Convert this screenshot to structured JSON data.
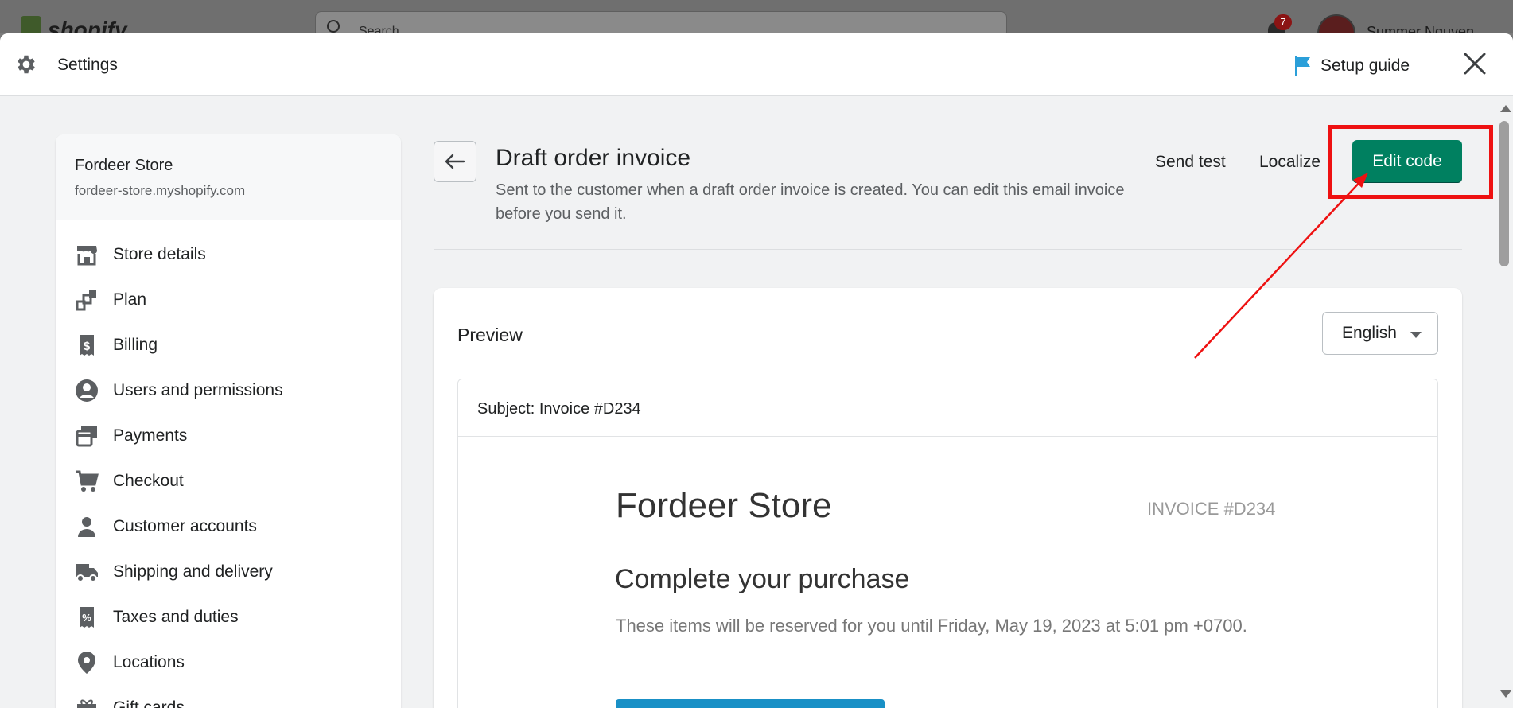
{
  "topbar": {
    "logo": "shopify",
    "search_placeholder": "Search",
    "notification_count": "7",
    "user_name": "Summer Nguyen"
  },
  "header": {
    "title": "Settings",
    "setup_guide": "Setup guide"
  },
  "sidebar": {
    "store_name": "Fordeer Store",
    "store_url": "fordeer-store.myshopify.com",
    "items": [
      {
        "label": "Store details",
        "icon": "store-icon"
      },
      {
        "label": "Plan",
        "icon": "plan-icon"
      },
      {
        "label": "Billing",
        "icon": "billing-icon"
      },
      {
        "label": "Users and permissions",
        "icon": "user-circle-icon"
      },
      {
        "label": "Payments",
        "icon": "payments-icon"
      },
      {
        "label": "Checkout",
        "icon": "cart-icon"
      },
      {
        "label": "Customer accounts",
        "icon": "person-icon"
      },
      {
        "label": "Shipping and delivery",
        "icon": "truck-icon"
      },
      {
        "label": "Taxes and duties",
        "icon": "tax-icon"
      },
      {
        "label": "Locations",
        "icon": "location-pin-icon"
      },
      {
        "label": "Gift cards",
        "icon": "gift-icon"
      }
    ]
  },
  "main": {
    "title": "Draft order invoice",
    "subtitle": "Sent to the customer when a draft order invoice is created. You can edit this email invoice before you send it.",
    "send_test": "Send test",
    "localize": "Localize",
    "edit_code": "Edit code"
  },
  "preview": {
    "title": "Preview",
    "language": "English",
    "subject": "Subject: Invoice #D234",
    "email": {
      "store_name": "Fordeer Store",
      "invoice_no": "INVOICE #D234",
      "heading": "Complete your purchase",
      "body": "These items will be reserved for you until Friday, May 19, 2023 at 5:01 pm +0700."
    }
  },
  "colors": {
    "primary": "#008060",
    "annotation": "#ee1111",
    "flag": "#2b9fd9"
  }
}
